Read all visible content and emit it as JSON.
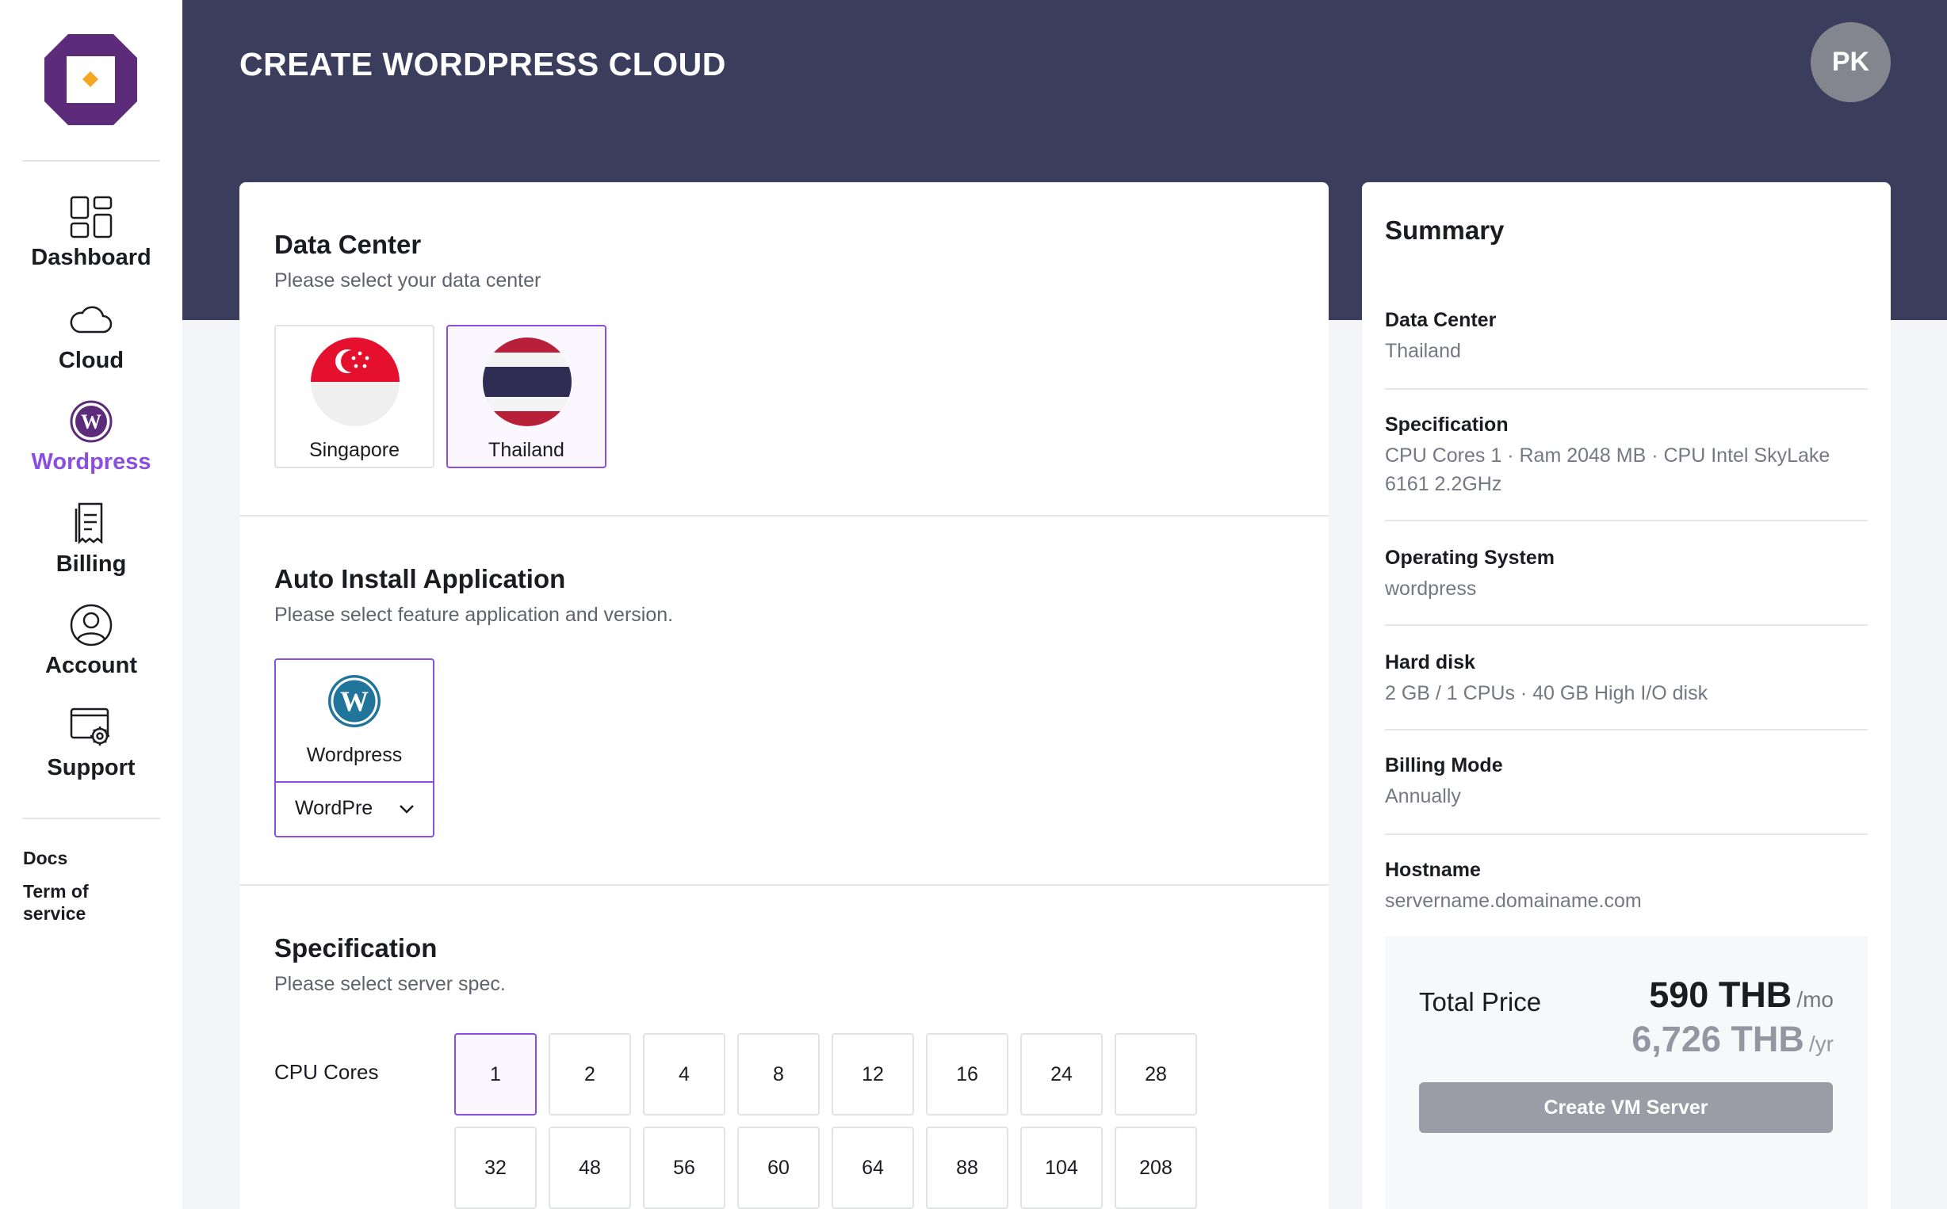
{
  "sidebar": {
    "nav": [
      {
        "label": "Dashboard",
        "icon": "dashboard-icon"
      },
      {
        "label": "Cloud",
        "icon": "cloud-icon"
      },
      {
        "label": "Wordpress",
        "icon": "wordpress-icon",
        "active": true
      },
      {
        "label": "Billing",
        "icon": "billing-icon"
      },
      {
        "label": "Account",
        "icon": "account-icon"
      },
      {
        "label": "Support",
        "icon": "support-icon"
      }
    ],
    "links": [
      "Docs",
      "Term of service"
    ]
  },
  "header": {
    "title": "CREATE WORDPRESS CLOUD",
    "avatar": "PK"
  },
  "data_center": {
    "title": "Data Center",
    "subtitle": "Please select your data center",
    "options": [
      {
        "label": "Singapore",
        "icon": "singapore-flag-icon"
      },
      {
        "label": "Thailand",
        "icon": "thailand-flag-icon",
        "selected": true
      }
    ]
  },
  "auto_install": {
    "title": "Auto Install Application",
    "subtitle": "Please select feature application and version.",
    "app_label": "Wordpress",
    "version_value": "WordPre"
  },
  "specification": {
    "title": "Specification",
    "subtitle": "Please select server spec.",
    "cpu_label": "CPU Cores",
    "cpu_options": [
      "1",
      "2",
      "4",
      "8",
      "12",
      "16",
      "24",
      "28",
      "32",
      "48",
      "56",
      "60",
      "64",
      "88",
      "104",
      "208"
    ],
    "cpu_selected": "1"
  },
  "summary": {
    "title": "Summary",
    "rows": [
      {
        "key": "Data Center",
        "value": "Thailand"
      },
      {
        "key": "Specification",
        "value": "CPU Cores 1  ·  Ram 2048 MB  ·  CPU Intel SkyLake 6161 2.2GHz"
      },
      {
        "key": "Operating System",
        "value": "wordpress"
      },
      {
        "key": "Hard disk",
        "value": "2 GB / 1 CPUs   · 40 GB High I/O disk"
      },
      {
        "key": "Billing Mode",
        "value": "Annually"
      },
      {
        "key": "Hostname",
        "value": "servername.domainame.com"
      }
    ],
    "total_label": "Total Price",
    "price_monthly": "590 THB",
    "price_monthly_unit": "/mo",
    "price_yearly": "6,726 THB",
    "price_yearly_unit": "/yr",
    "create_button": "Create VM Server"
  },
  "colors": {
    "header_bg": "#3b3d5c",
    "accent": "#8a4fe0",
    "logo_purple": "#5c2b7a",
    "logo_orange": "#f5a623",
    "button_disabled": "#9a9da6"
  }
}
